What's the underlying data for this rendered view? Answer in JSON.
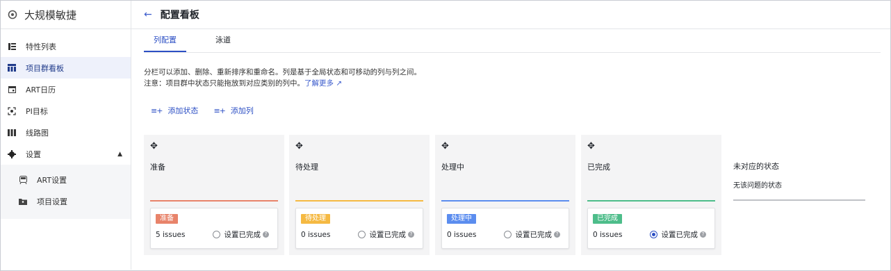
{
  "sidebar": {
    "brand": "大规模敏捷",
    "items": [
      {
        "label": "特性列表",
        "icon": "list-icon"
      },
      {
        "label": "项目群看板",
        "icon": "board-icon"
      },
      {
        "label": "ART日历",
        "icon": "calendar-icon"
      },
      {
        "label": "PI目标",
        "icon": "target-icon"
      },
      {
        "label": "线路图",
        "icon": "roadmap-icon"
      },
      {
        "label": "设置",
        "icon": "gear-icon"
      }
    ],
    "subitems": [
      {
        "label": "ART设置",
        "icon": "train-icon"
      },
      {
        "label": "项目设置",
        "icon": "folder-icon"
      }
    ]
  },
  "header": {
    "title": "配置看板"
  },
  "tabs": [
    {
      "label": "列配置"
    },
    {
      "label": "泳道"
    }
  ],
  "description": {
    "text": "分栏可以添加、删除、重新排序和重命名。列是基于全局状态和可移动的列与列之间。注意：项目群中状态只能拖放到对应类别的列中。",
    "link": "了解更多"
  },
  "actions": {
    "add_status": "添加状态",
    "add_column": "添加列"
  },
  "columns": [
    {
      "title": "准备",
      "badge": "准备",
      "issues": "5 issues",
      "done_label": "设置已完成",
      "color": "#e8836a",
      "selected": false
    },
    {
      "title": "待处理",
      "badge": "待处理",
      "issues": "0 issues",
      "done_label": "设置已完成",
      "color": "#f5b942",
      "selected": false
    },
    {
      "title": "处理中",
      "badge": "处理中",
      "issues": "0 issues",
      "done_label": "设置已完成",
      "color": "#5b8def",
      "selected": false
    },
    {
      "title": "已完成",
      "badge": "已完成",
      "issues": "0 issues",
      "done_label": "设置已完成",
      "color": "#4dbd8a",
      "selected": true
    }
  ],
  "unmapped": {
    "title": "未对应的状态",
    "text": "无该问题的状态"
  }
}
